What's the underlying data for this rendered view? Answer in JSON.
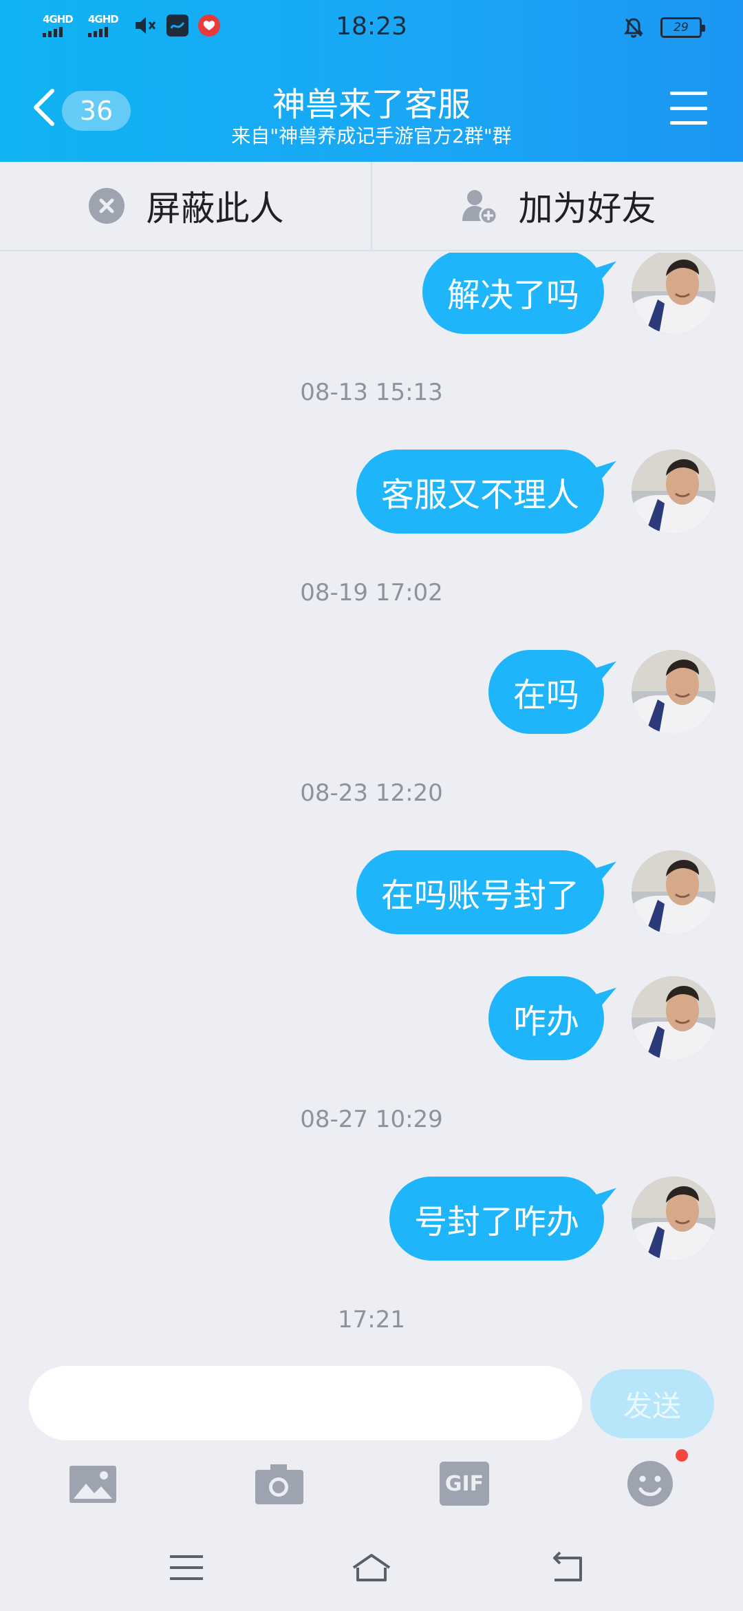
{
  "status_bar": {
    "signal1_label": "4GHD",
    "signal2_label": "4GHD",
    "time": "18:23",
    "battery": "29",
    "icons": [
      "mute-icon",
      "app-notification-icon",
      "weibo-icon",
      "bell-off-icon"
    ]
  },
  "header": {
    "unread_count": "36",
    "title": "神兽来了客服",
    "subtitle": "来自\"神兽养成记手游官方2群\"群"
  },
  "actions": {
    "block_label": "屏蔽此人",
    "add_friend_label": "加为好友"
  },
  "messages": [
    {
      "type": "msg",
      "text": "解决了吗"
    },
    {
      "type": "time",
      "text": "08-13 15:13"
    },
    {
      "type": "msg",
      "text": "客服又不理人"
    },
    {
      "type": "time",
      "text": "08-19 17:02"
    },
    {
      "type": "msg",
      "text": "在吗"
    },
    {
      "type": "time",
      "text": "08-23 12:20"
    },
    {
      "type": "msg",
      "text": "在吗账号封了"
    },
    {
      "type": "msg",
      "text": "咋办"
    },
    {
      "type": "time",
      "text": "08-27 10:29"
    },
    {
      "type": "msg",
      "text": "号封了咋办"
    },
    {
      "type": "time",
      "text": "17:21"
    }
  ],
  "composer": {
    "input_value": "",
    "send_label": "发送",
    "gif_label": "GIF"
  },
  "colors": {
    "header_gradient_start": "#0fb3f2",
    "header_gradient_end": "#1b97f3",
    "bubble": "#1fb5fb",
    "background": "#eceef4",
    "notification_dot": "#f6463e"
  }
}
